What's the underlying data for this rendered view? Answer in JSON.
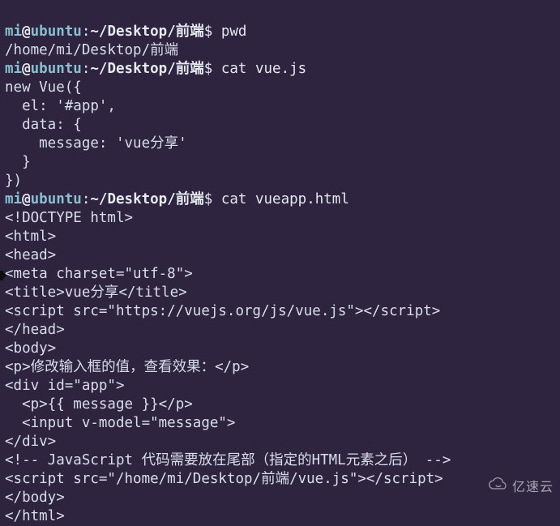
{
  "prompt": {
    "user": "mi",
    "at": "@",
    "host": "ubuntu",
    "colon": ":",
    "path": "~/Desktop/前端",
    "dollar": "$"
  },
  "cmd1": "pwd",
  "out1": "/home/mi/Desktop/前端",
  "cmd2": "cat vue.js",
  "file1_l1": "new Vue({",
  "file1_l2": "  el: '#app',",
  "file1_l3": "  data: {",
  "file1_l4": "    message: 'vue分享'",
  "file1_l5": "  }",
  "file1_l6": "})",
  "cmd3": "cat vueapp.html",
  "file2_l1": "<!DOCTYPE html>",
  "file2_l2": "<html>",
  "file2_l3": "<head>",
  "file2_l4": "<meta charset=\"utf-8\">",
  "file2_l5": "<title>vue分享</title>",
  "file2_l6": "<script src=\"https://vuejs.org/js/vue.js\"></script>",
  "file2_l7": "</head>",
  "file2_l8": "<body>",
  "file2_l9": "<p>修改输入框的值，查看效果：</p>",
  "file2_l10": "<div id=\"app\">",
  "file2_l11": "  <p>{{ message }}</p>",
  "file2_l12": "  <input v-model=\"message\">",
  "file2_l13": "</div>",
  "file2_l14": "<!-- JavaScript 代码需要放在尾部（指定的HTML元素之后） -->",
  "file2_l15": "<script src=\"/home/mi/Desktop/前端/vue.js\"></script>",
  "file2_l16": "</body>",
  "file2_l17": "</html>",
  "watermark_text": "亿速云"
}
